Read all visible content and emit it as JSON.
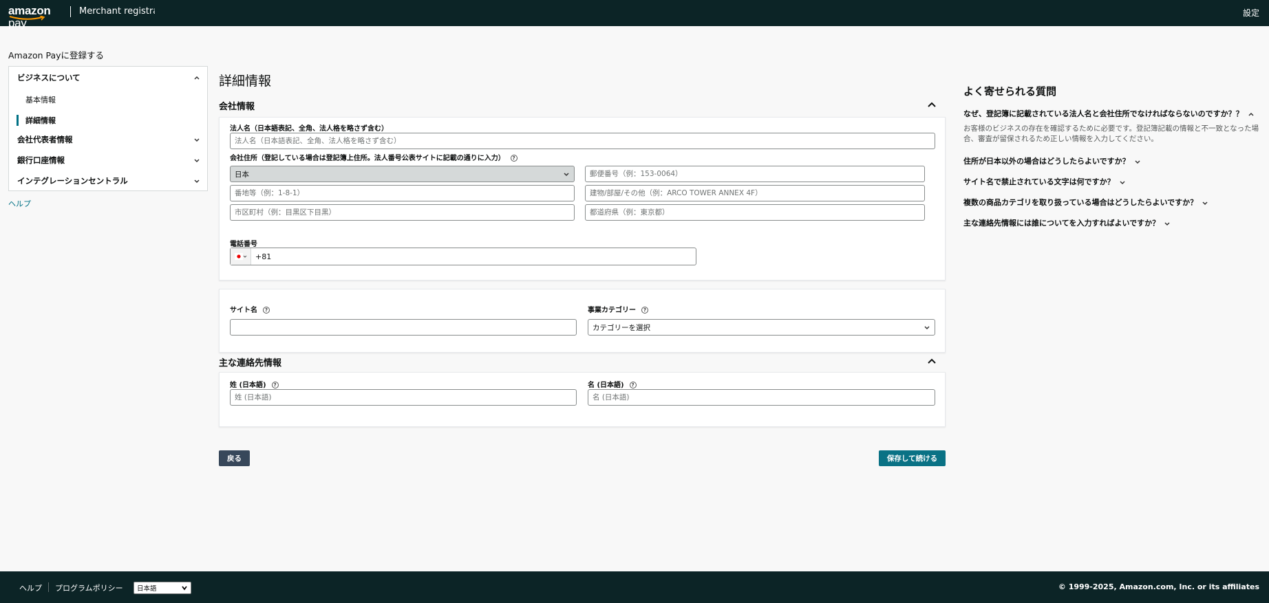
{
  "header": {
    "brand": "amazon",
    "brand_suffix": "pay",
    "title": "Merchant registration",
    "settings": "設定"
  },
  "sidebar": {
    "heading": "Amazon Payに登録する",
    "sections": [
      {
        "label": "ビジネスについて",
        "expanded": true,
        "items": [
          {
            "label": "基本情報"
          },
          {
            "label": "詳細情報",
            "active": true
          }
        ]
      },
      {
        "label": "会社代表者情報",
        "expanded": false
      },
      {
        "label": "銀行口座情報",
        "expanded": false
      },
      {
        "label": "インテグレーションセントラル",
        "expanded": false
      }
    ],
    "help": "ヘルプ"
  },
  "main": {
    "title": "詳細情報",
    "company_section": {
      "title": "会社情報",
      "legal_name_label": "法人名（日本語表記、全角、法人格を略さず含む）",
      "legal_name_placeholder": "法人名（日本語表記、全角、法人格を略さず含む）",
      "address_label": "会社住所（登記している場合は登記簿上住所。法人番号公表サイトに記載の通りに入力）",
      "country_value": "日本",
      "postal_placeholder": "郵便番号（例：153-0064）",
      "street_placeholder": "番地等（例：1-8-1）",
      "building_placeholder": "建物/部屋/その他（例：ARCO TOWER ANNEX 4F）",
      "city_placeholder": "市区町村（例：目黒区下目黒）",
      "prefecture_placeholder": "都道府県（例：東京都）",
      "phone_label": "電話番号",
      "phone_code": "+81"
    },
    "site_section": {
      "site_name_label": "サイト名",
      "site_name_value": "",
      "category_label": "事業カテゴリー",
      "category_value": "カテゴリーを選択"
    },
    "contact_section": {
      "title": "主な連絡先情報",
      "last_name_label": "姓 (日本語)",
      "last_name_placeholder": "姓 (日本語)",
      "first_name_label": "名 (日本語)",
      "first_name_placeholder": "名 (日本語)"
    },
    "back_button": "戻る",
    "save_button": "保存して続ける"
  },
  "faq": {
    "title": "よく寄せられる質問",
    "items": [
      {
        "q": "なぜ、登記簿に記載されている法人名と会社住所でなければならないのですか？？",
        "a": "お客様のビジネスの存在を確認するために必要です。登記簿記載の情報と不一致となった場合、審査が留保されるため正しい情報を入力してください。",
        "expanded": true
      },
      {
        "q": "住所が日本以外の場合はどうしたらよいですか？"
      },
      {
        "q": "サイト名で禁止されている文字は何ですか？"
      },
      {
        "q": "複数の商品カテゴリを取り扱っている場合はどうしたらよいですか？"
      },
      {
        "q": "主な連絡先情報には誰についてを入力すればよいですか？"
      }
    ]
  },
  "footer": {
    "help": "ヘルプ",
    "program_policy": "プログラムポリシー",
    "language": "日本語",
    "copyright": "© 1999-2025, Amazon.com, Inc. or its affiliates"
  },
  "colors": {
    "header_bg": "#0c2426",
    "accent": "#007185",
    "save_button": "#0a7285",
    "back_button": "#37475a",
    "logo_smile": "#ff9900"
  }
}
